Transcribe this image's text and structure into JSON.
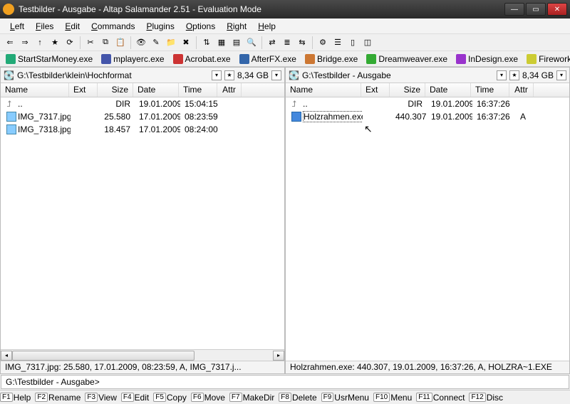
{
  "window": {
    "title": "Testbilder - Ausgabe - Altap Salamander 2.51 - Evaluation Mode"
  },
  "menus": [
    "Left",
    "Files",
    "Edit",
    "Commands",
    "Plugins",
    "Options",
    "Right",
    "Help"
  ],
  "apps": [
    {
      "label": "StartStarMoney.exe",
      "color": "#2a7"
    },
    {
      "label": "mplayerc.exe",
      "color": "#45a"
    },
    {
      "label": "Acrobat.exe",
      "color": "#c33"
    },
    {
      "label": "AfterFX.exe",
      "color": "#36a"
    },
    {
      "label": "Bridge.exe",
      "color": "#c73"
    },
    {
      "label": "Dreamweaver.exe",
      "color": "#3a3"
    },
    {
      "label": "InDesign.exe",
      "color": "#93c"
    },
    {
      "label": "Fireworks.exe",
      "color": "#cc3"
    }
  ],
  "left": {
    "path": "G:\\Testbilder\\klein\\Hochformat",
    "free": "8,34 GB",
    "cols": [
      "Name",
      "Ext",
      "Size",
      "Date",
      "Time",
      "Attr"
    ],
    "rows": [
      {
        "icon": "up",
        "name": "..",
        "ext": "",
        "size": "DIR",
        "date": "19.01.2009",
        "time": "15:04:15",
        "attr": ""
      },
      {
        "icon": "img",
        "name": "IMG_7317.jpg",
        "ext": "",
        "size": "25.580",
        "date": "17.01.2009",
        "time": "08:23:59",
        "attr": ""
      },
      {
        "icon": "img",
        "name": "IMG_7318.jpg",
        "ext": "",
        "size": "18.457",
        "date": "17.01.2009",
        "time": "08:24:00",
        "attr": ""
      }
    ],
    "status": "IMG_7317.jpg: 25.580, 17.01.2009, 08:23:59, A, IMG_7317.j..."
  },
  "right": {
    "path": "G:\\Testbilder - Ausgabe",
    "free": "8,34 GB",
    "cols": [
      "Name",
      "Ext",
      "Size",
      "Date",
      "Time",
      "Attr"
    ],
    "rows": [
      {
        "icon": "up",
        "name": "..",
        "ext": "",
        "size": "DIR",
        "date": "19.01.2009",
        "time": "16:37:26",
        "attr": ""
      },
      {
        "icon": "exe",
        "name": "Holzrahmen.exe",
        "ext": "",
        "size": "440.307",
        "date": "19.01.2009",
        "time": "16:37:26",
        "attr": "A",
        "selected": true
      }
    ],
    "status": "Holzrahmen.exe: 440.307, 19.01.2009, 16:37:26, A, HOLZRA~1.EXE"
  },
  "cmdline": "G:\\Testbilder - Ausgabe>",
  "fkeys": [
    {
      "k": "F1",
      "l": "Help"
    },
    {
      "k": "F2",
      "l": "Rename"
    },
    {
      "k": "F3",
      "l": "View"
    },
    {
      "k": "F4",
      "l": "Edit"
    },
    {
      "k": "F5",
      "l": "Copy"
    },
    {
      "k": "F6",
      "l": "Move"
    },
    {
      "k": "F7",
      "l": "MakeDir"
    },
    {
      "k": "F8",
      "l": "Delete"
    },
    {
      "k": "F9",
      "l": "UsrMenu"
    },
    {
      "k": "F10",
      "l": "Menu"
    },
    {
      "k": "F11",
      "l": "Connect"
    },
    {
      "k": "F12",
      "l": "Disc"
    }
  ]
}
